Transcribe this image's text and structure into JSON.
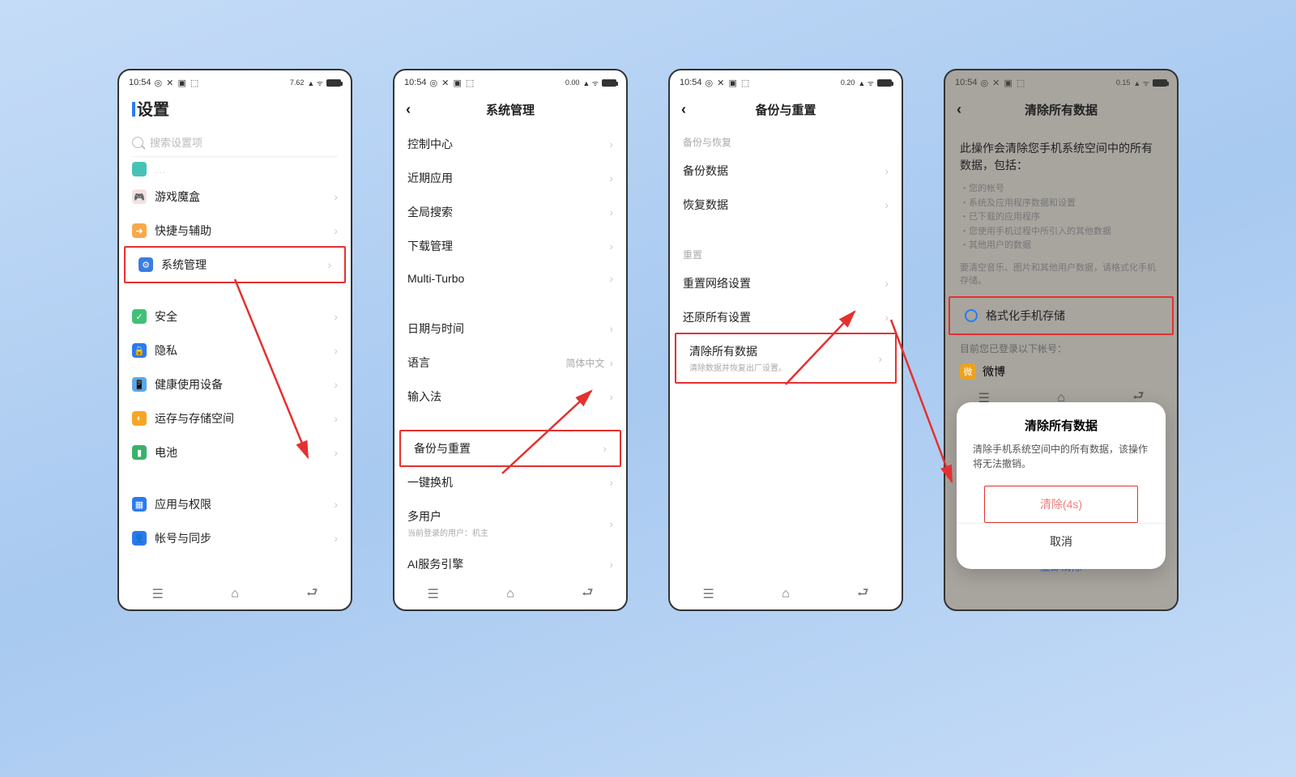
{
  "status": {
    "time": "10:54",
    "icons": "◎ ✕ ▣ ⬚",
    "right_small1": "7.62",
    "right_small2": "0.00",
    "right_small3": "0.20",
    "right_small4": "0.15",
    "wifi": "▲ ᯤ"
  },
  "s1": {
    "title": "设置",
    "search_placeholder": "搜索设置项",
    "items": [
      {
        "label": "游戏魔盒",
        "icon_color": "#f3e1e1",
        "glyph": "🎮"
      },
      {
        "label": "快捷与辅助",
        "icon_color": "#f8a94a",
        "glyph": "➜"
      },
      {
        "label": "系统管理",
        "icon_color": "#3a7de0",
        "glyph": "⚙"
      },
      {
        "label": "安全",
        "icon_color": "#43c077",
        "glyph": "✓"
      },
      {
        "label": "隐私",
        "icon_color": "#2a7af2",
        "glyph": "🔒"
      },
      {
        "label": "健康使用设备",
        "icon_color": "#5aa7e8",
        "glyph": "📱"
      },
      {
        "label": "运存与存储空间",
        "icon_color": "#f5a623",
        "glyph": "◐"
      },
      {
        "label": "电池",
        "icon_color": "#39b26b",
        "glyph": "▮"
      },
      {
        "label": "应用与权限",
        "icon_color": "#2a7af2",
        "glyph": "▦"
      },
      {
        "label": "帐号与同步",
        "icon_color": "#2a7af2",
        "glyph": "👤"
      }
    ]
  },
  "s2": {
    "title": "系统管理",
    "items1": [
      "控制中心",
      "近期应用",
      "全局搜索",
      "下载管理",
      "Multi-Turbo"
    ],
    "items2": [
      {
        "label": "日期与时间"
      },
      {
        "label": "语言",
        "value": "简体中文"
      },
      {
        "label": "输入法"
      }
    ],
    "items3": [
      {
        "label": "备份与重置"
      },
      {
        "label": "一键换机"
      },
      {
        "label": "多用户",
        "sub": "当前登录的用户：机主"
      },
      {
        "label": "AI服务引擎"
      }
    ]
  },
  "s3": {
    "title": "备份与重置",
    "section1": "备份与恢复",
    "items1": [
      "备份数据",
      "恢复数据"
    ],
    "section2": "重置",
    "items2": [
      {
        "label": "重置网络设置"
      },
      {
        "label": "还原所有设置"
      },
      {
        "label": "清除所有数据",
        "sub": "清除数据并恢复出厂设置。"
      }
    ]
  },
  "s4": {
    "title": "清除所有数据",
    "warn": "此操作会清除您手机系统空间中的所有数据，包括：",
    "bullets": [
      "您的帐号",
      "系统及应用程序数据和设置",
      "已下载的应用程序",
      "您使用手机过程中所引入的其他数据",
      "其他用户的数据"
    ],
    "note": "要清空音乐、图片和其他用户数据，请格式化手机存储。",
    "format_label": "格式化手机存储",
    "loggedin": "目前您已登录以下帐号：",
    "app": "微博",
    "imm": "立即清除",
    "dialog": {
      "title": "清除所有数据",
      "msg": "清除手机系统空间中的所有数据，该操作将无法撤销。",
      "confirm": "清除(4s)",
      "cancel": "取消"
    }
  }
}
